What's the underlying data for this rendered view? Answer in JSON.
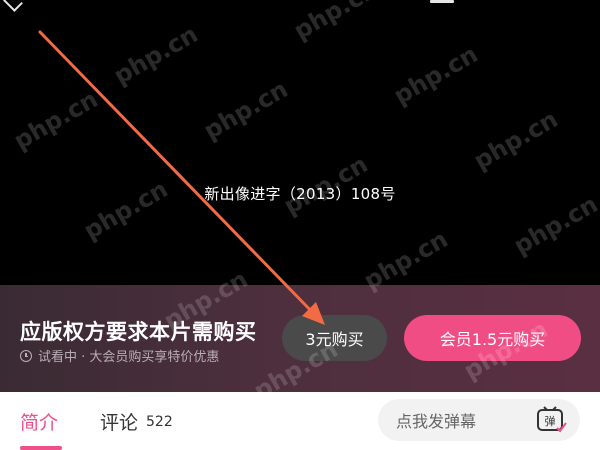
{
  "player": {
    "license_text": "新出像进字（2013）108号"
  },
  "paywall": {
    "title": "应版权方要求本片需购买",
    "subtitle": "试看中 · 大会员购买享特价优惠",
    "buy_label": "3元购买",
    "vip_label": "会员1.5元购买"
  },
  "tabs": {
    "intro": "简介",
    "comments": "评论",
    "comments_count": "522"
  },
  "danmaku": {
    "placeholder": "点我发弹幕",
    "toggle_glyph": "弹"
  },
  "watermark": {
    "text": "php.cn"
  },
  "colors": {
    "accent": "#f0508a",
    "arrow": "#f26b45"
  }
}
